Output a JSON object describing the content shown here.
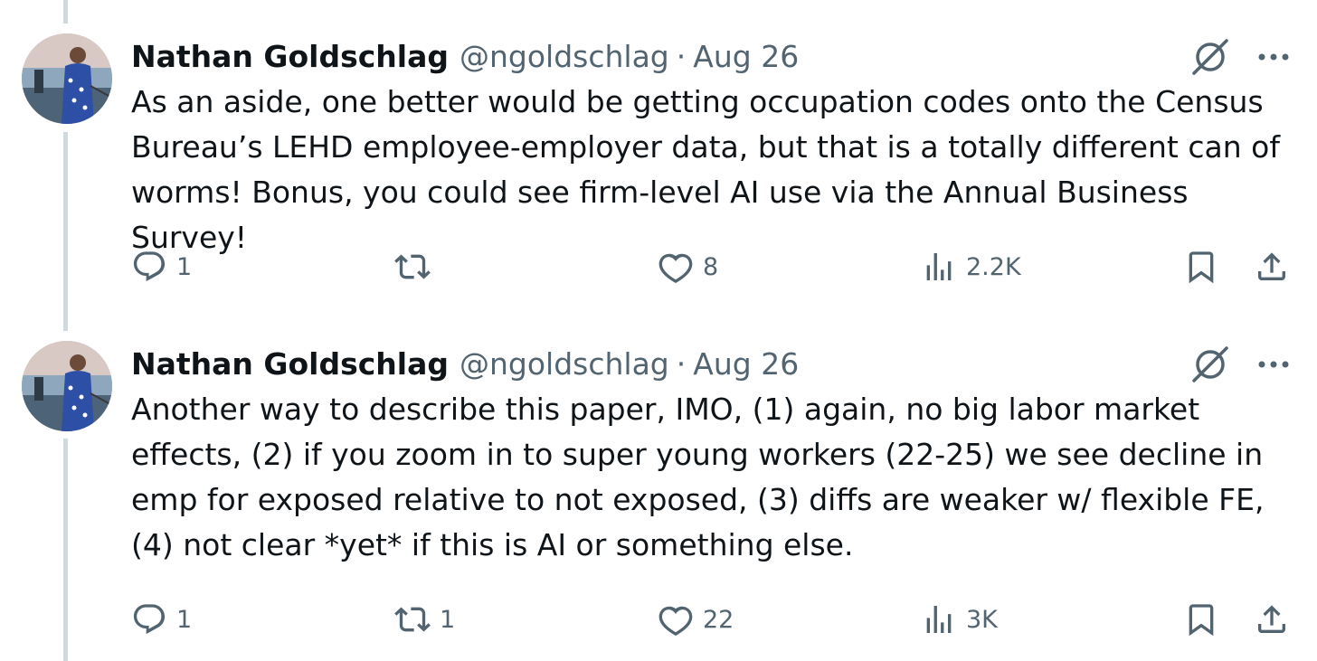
{
  "tweets": [
    {
      "name": "Nathan Goldschlag",
      "handle": "@ngoldschlag",
      "separator": "·",
      "date": "Aug 26",
      "text": "As an aside, one better would be getting occupation codes onto the Census Bureau’s LEHD employee-employer data, but that is a totally different can of worms! Bonus, you could see firm-level AI use via the Annual Business Survey!",
      "replies": "1",
      "reposts": "",
      "likes": "8",
      "views": "2.2K"
    },
    {
      "name": "Nathan Goldschlag",
      "handle": "@ngoldschlag",
      "separator": "·",
      "date": "Aug 26",
      "text": "Another way to describe this paper, IMO, (1) again, no big labor market effects, (2) if you zoom in to super young workers (22-25) we see decline in emp for exposed relative to not exposed, (3) diffs are weaker w/ flexible FE, (4) not clear *yet* if this is AI or something else.",
      "replies": "1",
      "reposts": "1",
      "likes": "22",
      "views": "3K"
    }
  ],
  "icons": {
    "reply": "reply-icon",
    "repost": "repost-icon",
    "like": "heart-icon",
    "views": "views-icon",
    "bookmark": "bookmark-icon",
    "share": "share-icon",
    "grok": "grok-icon",
    "more": "more-icon"
  },
  "colors": {
    "text": "#0f1419",
    "secondary": "#536471",
    "thread_line": "#cfd9de",
    "background": "#ffffff"
  }
}
